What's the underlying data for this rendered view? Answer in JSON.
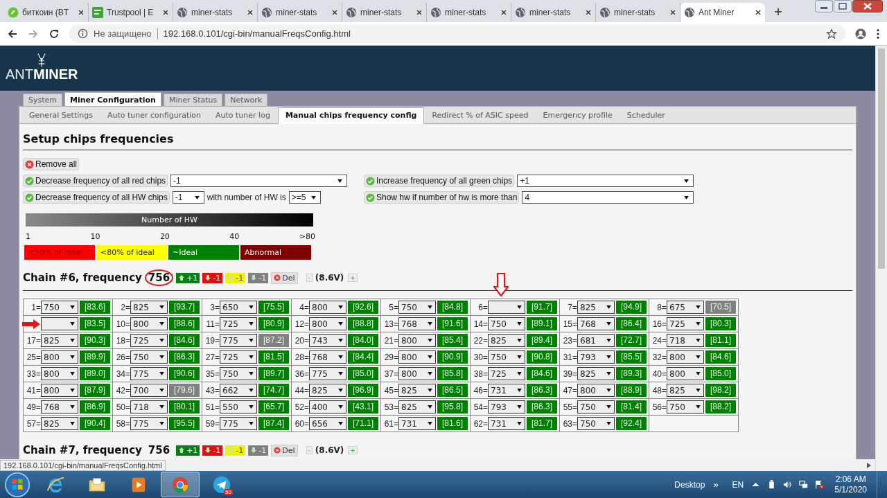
{
  "browser": {
    "tabs": [
      {
        "title": "биткоин (BT",
        "kind": "coin",
        "selected": false
      },
      {
        "title": "Trustpool | E",
        "kind": "pool",
        "selected": false
      },
      {
        "title": "miner-stats",
        "kind": "globe",
        "selected": false
      },
      {
        "title": "miner-stats",
        "kind": "globe",
        "selected": false
      },
      {
        "title": "miner-stats",
        "kind": "globe",
        "selected": false
      },
      {
        "title": "miner-stats",
        "kind": "globe",
        "selected": false
      },
      {
        "title": "miner-stats",
        "kind": "globe",
        "selected": false
      },
      {
        "title": "miner-stats",
        "kind": "globe",
        "selected": false
      },
      {
        "title": "Ant Miner",
        "kind": "globe",
        "selected": true
      }
    ],
    "security": "Не защищено",
    "url": "192.168.0.101/cgi-bin/manualFreqsConfig.html"
  },
  "header": {
    "logo_light": "ANT",
    "logo_bold": "MINER"
  },
  "main_tabs": [
    {
      "label": "System",
      "selected": false
    },
    {
      "label": "Miner Configuration",
      "selected": true
    },
    {
      "label": "Miner Status",
      "selected": false
    },
    {
      "label": "Network",
      "selected": false
    }
  ],
  "sub_tabs": [
    {
      "label": "General Settings",
      "selected": false
    },
    {
      "label": "Auto tuner configuration",
      "selected": false
    },
    {
      "label": "Auto tuner log",
      "selected": false
    },
    {
      "label": "Manual chips frequency config",
      "selected": true
    },
    {
      "label": "Redirect % of ASIC speed",
      "selected": false
    },
    {
      "label": "Emergency profile",
      "selected": false
    },
    {
      "label": "Scheduler",
      "selected": false
    }
  ],
  "title": "Setup chips frequencies",
  "remove_all": "Remove all",
  "action_rows": [
    [
      {
        "items": [
          {
            "kind": "button",
            "label": "Decrease frequency of all red chips"
          },
          {
            "kind": "dropdown",
            "value": "-1"
          }
        ]
      },
      {
        "items": [
          {
            "kind": "button",
            "label": "Increase frequency of all green chips"
          },
          {
            "kind": "dropdown",
            "value": "+1"
          }
        ]
      }
    ],
    [
      {
        "items": [
          {
            "kind": "button",
            "label": "Decrease frequency of all HW chips"
          },
          {
            "kind": "short-dropdown",
            "value": "-1"
          },
          {
            "kind": "text",
            "label": "with number of HW is"
          },
          {
            "kind": "short-dropdown",
            "value": ">=5"
          }
        ]
      },
      {
        "items": [
          {
            "kind": "button",
            "label": "Show hw if number of hw is more than"
          },
          {
            "kind": "dropdown",
            "value": "4"
          }
        ]
      }
    ]
  ],
  "hw_scale": {
    "title": "Number of HW",
    "ticks": [
      "1",
      "10",
      "20",
      "40",
      ">80"
    ]
  },
  "legend": [
    {
      "label": "<50% of ideal",
      "color": "#ff0000"
    },
    {
      "label": "<80% of ideal",
      "color": "#ffff00"
    },
    {
      "label": "~Ideal",
      "color": "#008000"
    },
    {
      "label": "Abnormal",
      "color": "#800000"
    }
  ],
  "chains": [
    {
      "title": "Chain #6, frequency",
      "frequency": "756",
      "highlighted": true,
      "buttons": [
        {
          "kind": "up",
          "label": "+1"
        },
        {
          "kind": "down-red",
          "label": "-1"
        },
        {
          "kind": "down-yellow",
          "label": "-1"
        },
        {
          "kind": "down-grey",
          "label": "-1"
        },
        {
          "kind": "del",
          "label": "Del"
        }
      ],
      "voltage_minus": "-",
      "voltage": "(8.6V)",
      "voltage_plus": "+",
      "chips": [
        {
          "kind": "plain",
          "label": "1=",
          "value": "750",
          "reading": "[83.6]",
          "color": "#008000"
        },
        {
          "kind": "plain",
          "label": "2=",
          "value": "825",
          "reading": "[93.7]",
          "color": "#008000"
        },
        {
          "kind": "plain",
          "label": "3=",
          "value": "650",
          "reading": "[75.5]",
          "color": "#008000"
        },
        {
          "kind": "plain",
          "label": "4=",
          "value": "800",
          "reading": "[92.6]",
          "color": "#008000"
        },
        {
          "kind": "plain",
          "label": "5=",
          "value": "750",
          "reading": "[84.8]",
          "color": "#008000"
        },
        {
          "kind": "arrow-above",
          "label": "6=",
          "reading": "[91.7]",
          "color": "#008000"
        },
        {
          "kind": "plain",
          "label": "7=",
          "value": "825",
          "reading": "[94.9]",
          "color": "#008000"
        },
        {
          "kind": "plain",
          "label": "8=",
          "value": "675",
          "reading": "[70.5]",
          "color": "#808080"
        },
        {
          "kind": "arrow-left",
          "reading": "[83.5]",
          "color": "#008000"
        },
        {
          "kind": "plain",
          "label": "10=",
          "value": "800",
          "reading": "[88.6]",
          "color": "#008000"
        },
        {
          "kind": "plain",
          "label": "11=",
          "value": "725",
          "reading": "[80.9]",
          "color": "#008000"
        },
        {
          "kind": "plain",
          "label": "12=",
          "value": "800",
          "reading": "[88.8]",
          "color": "#008000"
        },
        {
          "kind": "plain",
          "label": "13=",
          "value": "768",
          "reading": "[91.6]",
          "color": "#008000"
        },
        {
          "kind": "plain",
          "label": "14=",
          "value": "750",
          "reading": "[89.1]",
          "color": "#008000"
        },
        {
          "kind": "plain",
          "label": "15=",
          "value": "768",
          "reading": "[86.4]",
          "color": "#008000"
        },
        {
          "kind": "plain",
          "label": "16=",
          "value": "725",
          "reading": "[80.3]",
          "color": "#008000"
        },
        {
          "kind": "plain",
          "label": "17=",
          "value": "825",
          "reading": "[90.3]",
          "color": "#008000"
        },
        {
          "kind": "plain",
          "label": "18=",
          "value": "725",
          "reading": "[84.6]",
          "color": "#008000"
        },
        {
          "kind": "plain",
          "label": "19=",
          "value": "775",
          "reading": "[87.2]",
          "color": "#808080"
        },
        {
          "kind": "plain",
          "label": "20=",
          "value": "743",
          "reading": "[84.0]",
          "color": "#008000"
        },
        {
          "kind": "plain",
          "label": "21=",
          "value": "800",
          "reading": "[85.4]",
          "color": "#008000"
        },
        {
          "kind": "plain",
          "label": "22=",
          "value": "825",
          "reading": "[89.4]",
          "color": "#008000"
        },
        {
          "kind": "plain",
          "label": "23=",
          "value": "681",
          "reading": "[72.7]",
          "color": "#008000"
        },
        {
          "kind": "plain",
          "label": "24=",
          "value": "718",
          "reading": "[81.1]",
          "color": "#008000"
        },
        {
          "kind": "plain",
          "label": "25=",
          "value": "800",
          "reading": "[89.9]",
          "color": "#008000"
        },
        {
          "kind": "plain",
          "label": "26=",
          "value": "750",
          "reading": "[86.3]",
          "color": "#008000"
        },
        {
          "kind": "plain",
          "label": "27=",
          "value": "725",
          "reading": "[81.5]",
          "color": "#008000"
        },
        {
          "kind": "plain",
          "label": "28=",
          "value": "768",
          "reading": "[84.4]",
          "color": "#008000"
        },
        {
          "kind": "plain",
          "label": "29=",
          "value": "800",
          "reading": "[90.9]",
          "color": "#008000"
        },
        {
          "kind": "plain",
          "label": "30=",
          "value": "750",
          "reading": "[90.8]",
          "color": "#008000"
        },
        {
          "kind": "plain",
          "label": "31=",
          "value": "793",
          "reading": "[85.5]",
          "color": "#008000"
        },
        {
          "kind": "plain",
          "label": "32=",
          "value": "800",
          "reading": "[84.6]",
          "color": "#008000"
        },
        {
          "kind": "plain",
          "label": "33=",
          "value": "800",
          "reading": "[89.0]",
          "color": "#008000"
        },
        {
          "kind": "plain",
          "label": "34=",
          "value": "775",
          "reading": "[90.6]",
          "color": "#008000"
        },
        {
          "kind": "plain",
          "label": "35=",
          "value": "750",
          "reading": "[89.7]",
          "color": "#008000"
        },
        {
          "kind": "plain",
          "label": "36=",
          "value": "775",
          "reading": "[85.0]",
          "color": "#008000"
        },
        {
          "kind": "plain",
          "label": "37=",
          "value": "800",
          "reading": "[85.8]",
          "color": "#008000"
        },
        {
          "kind": "plain",
          "label": "38=",
          "value": "725",
          "reading": "[84.6]",
          "color": "#008000"
        },
        {
          "kind": "plain",
          "label": "39=",
          "value": "825",
          "reading": "[89.3]",
          "color": "#008000"
        },
        {
          "kind": "plain",
          "label": "40=",
          "value": "800",
          "reading": "[85.0]",
          "color": "#008000"
        },
        {
          "kind": "plain",
          "label": "41=",
          "value": "800",
          "reading": "[87.9]",
          "color": "#008000"
        },
        {
          "kind": "plain",
          "label": "42=",
          "value": "700",
          "reading": "[79.6]",
          "color": "#808080"
        },
        {
          "kind": "plain",
          "label": "43=",
          "value": "662",
          "reading": "[74.7]",
          "color": "#008000"
        },
        {
          "kind": "plain",
          "label": "44=",
          "value": "825",
          "reading": "[96.9]",
          "color": "#008000"
        },
        {
          "kind": "plain",
          "label": "45=",
          "value": "825",
          "reading": "[86.5]",
          "color": "#008000"
        },
        {
          "kind": "plain",
          "label": "46=",
          "value": "731",
          "reading": "[86.3]",
          "color": "#008000"
        },
        {
          "kind": "plain",
          "label": "47=",
          "value": "800",
          "reading": "[88.9]",
          "color": "#008000"
        },
        {
          "kind": "plain",
          "label": "48=",
          "value": "825",
          "reading": "[98.2]",
          "color": "#008000"
        },
        {
          "kind": "plain",
          "label": "49=",
          "value": "768",
          "reading": "[86.9]",
          "color": "#008000"
        },
        {
          "kind": "plain",
          "label": "50=",
          "value": "718",
          "reading": "[80.1]",
          "color": "#008000"
        },
        {
          "kind": "plain",
          "label": "51=",
          "value": "550",
          "reading": "[65.7]",
          "color": "#008000"
        },
        {
          "kind": "plain",
          "label": "52=",
          "value": "400",
          "reading": "[43.1]",
          "color": "#008000"
        },
        {
          "kind": "plain",
          "label": "53=",
          "value": "825",
          "reading": "[95.8]",
          "color": "#008000"
        },
        {
          "kind": "plain",
          "label": "54=",
          "value": "793",
          "reading": "[86.3]",
          "color": "#008000"
        },
        {
          "kind": "plain",
          "label": "55=",
          "value": "750",
          "reading": "[81.4]",
          "color": "#008000"
        },
        {
          "kind": "plain",
          "label": "56=",
          "value": "750",
          "reading": "[88.2]",
          "color": "#008000"
        },
        {
          "kind": "plain",
          "label": "57=",
          "value": "825",
          "reading": "[90.4]",
          "color": "#008000"
        },
        {
          "kind": "plain",
          "label": "58=",
          "value": "775",
          "reading": "[95.5]",
          "color": "#008000"
        },
        {
          "kind": "plain",
          "label": "59=",
          "value": "775",
          "reading": "[87.4]",
          "color": "#008000"
        },
        {
          "kind": "plain",
          "label": "60=",
          "value": "656",
          "reading": "[71.1]",
          "color": "#008000"
        },
        {
          "kind": "plain",
          "label": "61=",
          "value": "731",
          "reading": "[81.6]",
          "color": "#008000"
        },
        {
          "kind": "plain",
          "label": "62=",
          "value": "731",
          "reading": "[81.7]",
          "color": "#008000"
        },
        {
          "kind": "plain",
          "label": "63=",
          "value": "750",
          "reading": "[92.4]",
          "color": "#008000"
        }
      ]
    },
    {
      "title": "Chain #7, frequency",
      "frequency": "756",
      "highlighted": false,
      "buttons": [
        {
          "kind": "up",
          "label": "+1"
        },
        {
          "kind": "down-red",
          "label": "-1"
        },
        {
          "kind": "down-yellow",
          "label": "-1"
        },
        {
          "kind": "down-grey",
          "label": "-1"
        },
        {
          "kind": "del",
          "label": "Del"
        }
      ],
      "voltage_minus": "-",
      "voltage": "(8.6V)",
      "voltage_plus": "+"
    }
  ],
  "status_url": "192.168.0.101/cgi-bin/manualFreqsConfig.html",
  "taskbar": {
    "apps": [
      {
        "kind": "ie",
        "selected": false
      },
      {
        "kind": "explorer",
        "selected": false
      },
      {
        "kind": "media",
        "selected": false
      },
      {
        "kind": "chrome",
        "selected": true
      },
      {
        "kind": "telegram",
        "selected": false,
        "badge": "50"
      }
    ],
    "desktop": "Desktop",
    "more": "»",
    "language": "EN",
    "time": "2:06 AM",
    "date": "5/1/2020"
  }
}
